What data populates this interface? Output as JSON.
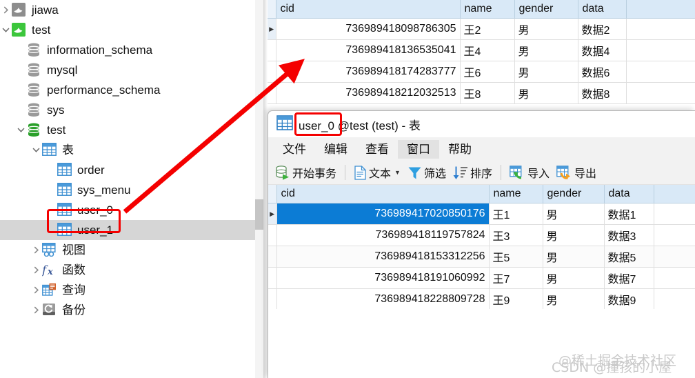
{
  "app": {
    "name": "navicat",
    "accent": "#0c7cd5",
    "annotation_color": "#f40000"
  },
  "sidebar": {
    "name": "connection-tree",
    "items": [
      {
        "label": "jiawa",
        "icon": "connection-icon",
        "state": "collapsed",
        "indent": 0,
        "icon_color": "#8d8d8d",
        "selected": false
      },
      {
        "label": "test",
        "icon": "connection-icon",
        "state": "expanded",
        "indent": 0,
        "icon_color": "#3cc63c",
        "selected": false
      },
      {
        "label": "information_schema",
        "icon": "database-icon",
        "state": "none",
        "indent": 1,
        "icon_color": "#9a9a9a",
        "selected": false
      },
      {
        "label": "mysql",
        "icon": "database-icon",
        "state": "none",
        "indent": 1,
        "icon_color": "#9a9a9a",
        "selected": false
      },
      {
        "label": "performance_schema",
        "icon": "database-icon",
        "state": "none",
        "indent": 1,
        "icon_color": "#9a9a9a",
        "selected": false
      },
      {
        "label": "sys",
        "icon": "database-icon",
        "state": "none",
        "indent": 1,
        "icon_color": "#9a9a9a",
        "selected": false
      },
      {
        "label": "test",
        "icon": "database-icon",
        "state": "expanded",
        "indent": 1,
        "icon_color": "#2aa02a",
        "selected": false
      },
      {
        "label": "表",
        "icon": "table-folder-icon",
        "state": "expanded",
        "indent": 2,
        "icon_color": "#3d8fd1",
        "selected": false
      },
      {
        "label": "order",
        "icon": "table-icon",
        "state": "none",
        "indent": 3,
        "icon_color": "#3d8fd1",
        "selected": false
      },
      {
        "label": "sys_menu",
        "icon": "table-icon",
        "state": "none",
        "indent": 3,
        "icon_color": "#3d8fd1",
        "selected": false
      },
      {
        "label": "user_0",
        "icon": "table-icon",
        "state": "none",
        "indent": 3,
        "icon_color": "#3d8fd1",
        "selected": false
      },
      {
        "label": "user_1",
        "icon": "table-icon",
        "state": "none",
        "indent": 3,
        "icon_color": "#3d8fd1",
        "selected": true,
        "highlighted": true
      },
      {
        "label": "视图",
        "icon": "view-icon",
        "state": "collapsed",
        "indent": 2,
        "icon_color": "#3d8fd1",
        "selected": false
      },
      {
        "label": "函数",
        "icon": "function-icon",
        "state": "collapsed",
        "indent": 2,
        "icon_color": "#3c5a99",
        "selected": false
      },
      {
        "label": "查询",
        "icon": "query-icon",
        "state": "collapsed",
        "indent": 2,
        "icon_color": "#d2622c",
        "selected": false
      },
      {
        "label": "备份",
        "icon": "backup-icon",
        "state": "collapsed",
        "indent": 2,
        "icon_color": "#6b6b6b",
        "selected": false
      }
    ],
    "scrollbar": {
      "name": "tree-vertical-scrollbar"
    }
  },
  "background_window": {
    "name": "user-1-data-grid",
    "columns": [
      "cid",
      "name",
      "gender",
      "data"
    ],
    "rows": [
      {
        "cid": "736989418098786305",
        "name": "王2",
        "gender": "男",
        "data": "数据2",
        "current": true
      },
      {
        "cid": "736989418136535041",
        "name": "王4",
        "gender": "男",
        "data": "数据4",
        "current": false
      },
      {
        "cid": "736989418174283777",
        "name": "王6",
        "gender": "男",
        "data": "数据6",
        "current": false
      },
      {
        "cid": "736989418212032513",
        "name": "王8",
        "gender": "男",
        "data": "数据8",
        "current": false
      }
    ]
  },
  "foreground_window": {
    "name": "user-0-table-window",
    "title_table": "user_0",
    "title_rest": "@test (test) - 表",
    "title_highlighted": true,
    "menu": [
      {
        "label": "文件",
        "hovered": false
      },
      {
        "label": "编辑",
        "hovered": false
      },
      {
        "label": "查看",
        "hovered": false
      },
      {
        "label": "窗口",
        "hovered": true
      },
      {
        "label": "帮助",
        "hovered": false
      }
    ],
    "toolbar": [
      {
        "label": "开始事务",
        "icon": "begin-transaction-icon",
        "dropdown": false
      },
      {
        "label": "文本",
        "icon": "text-document-icon",
        "dropdown": true
      },
      {
        "label": "筛选",
        "icon": "filter-funnel-icon",
        "dropdown": false
      },
      {
        "label": "排序",
        "icon": "sort-descending-icon",
        "dropdown": false
      },
      {
        "label": "导入",
        "icon": "import-icon",
        "dropdown": false
      },
      {
        "label": "导出",
        "icon": "export-icon",
        "dropdown": false
      }
    ],
    "grid": {
      "name": "user-0-data-grid",
      "columns": [
        "cid",
        "name",
        "gender",
        "data"
      ],
      "rows": [
        {
          "cid": "736989417020850176",
          "name": "王1",
          "gender": "男",
          "data": "数据1",
          "selected": true
        },
        {
          "cid": "736989418119757824",
          "name": "王3",
          "gender": "男",
          "data": "数据3",
          "selected": false
        },
        {
          "cid": "736989418153312256",
          "name": "王5",
          "gender": "男",
          "data": "数据5",
          "selected": false
        },
        {
          "cid": "736989418191060992",
          "name": "王7",
          "gender": "男",
          "data": "数据7",
          "selected": false
        },
        {
          "cid": "736989418228809728",
          "name": "王9",
          "gender": "男",
          "data": "数据9",
          "selected": false
        }
      ]
    }
  },
  "annotations": {
    "arrow": {
      "name": "red-pointer-arrow",
      "from": "user_1 tree node",
      "to": "user_1 grid data"
    },
    "box_tree": {
      "name": "red-highlight-box-user-1"
    },
    "box_title": {
      "name": "red-highlight-box-user-0"
    }
  },
  "watermarks": {
    "juejin": "@稀土掘金技术社区",
    "csdn": "CSDN @撞孩的小屋"
  }
}
